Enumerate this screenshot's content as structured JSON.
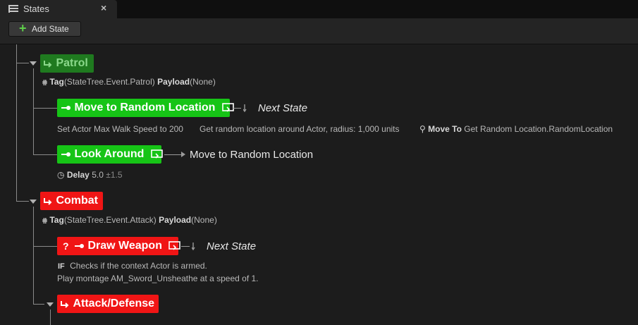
{
  "tab": {
    "title": "States",
    "close": "×"
  },
  "toolbar": {
    "add_label": "Add State"
  },
  "patrol": {
    "name": "Patrol",
    "tag_label": "Tag",
    "tag_value": "(StateTree.Event.Patrol)",
    "payload_label": "Payload",
    "payload_value": "(None)",
    "move": {
      "name": "Move to Random Location",
      "transition": "Next State",
      "task1": "Set Actor Max Walk Speed to 200",
      "task2": "Get random location around Actor, radius: 1,000 units",
      "task3_label": "Move To",
      "task3_value": "Get Random Location.RandomLocation"
    },
    "look": {
      "name": "Look Around",
      "transition": "Move to Random Location",
      "delay_label": "Delay",
      "delay_value": "5.0",
      "delay_variance": "±1.5"
    }
  },
  "combat": {
    "name": "Combat",
    "tag_label": "Tag",
    "tag_value": "(StateTree.Event.Attack)",
    "payload_label": "Payload",
    "payload_value": "(None)",
    "draw": {
      "prefix": "?",
      "name": "Draw Weapon",
      "transition": "Next State",
      "if_label": "IF",
      "condition": "Checks if the context Actor is armed.",
      "task": "Play montage AM_Sword_Unsheathe at a speed of 1."
    },
    "attack": {
      "name": "Attack/Defense"
    }
  },
  "colors": {
    "patrol_bg": "#1f7a1f",
    "child_green": "#16c416",
    "combat_red": "#f01515"
  }
}
